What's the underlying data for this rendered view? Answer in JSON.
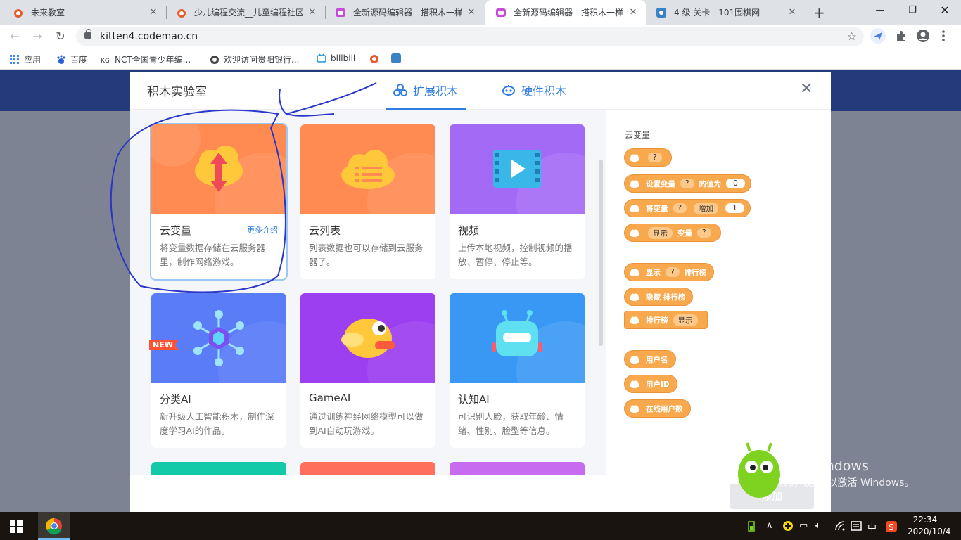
{
  "browser": {
    "tabs": [
      {
        "title": "未来教室",
        "active": false
      },
      {
        "title": "少儿编程交流__儿童编程社区_",
        "active": false
      },
      {
        "title": "全新源码编辑器 - 搭积木一样",
        "active": false
      },
      {
        "title": "全新源码编辑器 - 搭积木一样",
        "active": true
      },
      {
        "title": "4 级 关卡 - 101围棋网",
        "active": false
      }
    ],
    "new_tab": "+",
    "close_glyph": "✕",
    "url": "kitten4.codemao.cn",
    "bookmarks": [
      "应用",
      "百度",
      "NCT全国青少年编...",
      "欢迎访问贵阳银行...",
      "billbill"
    ]
  },
  "modal": {
    "title": "积木实验室",
    "tabs": [
      {
        "label": "扩展积木",
        "selected": true
      },
      {
        "label": "硬件积木",
        "selected": false
      }
    ],
    "close": "✕",
    "cards": [
      {
        "name": "云变量",
        "more": "更多介绍",
        "desc": "将变量数据存储在云服务器里，制作网络游戏。",
        "color": "#ff8a52"
      },
      {
        "name": "云列表",
        "desc": "列表数据也可以存储到云服务器了。",
        "color": "#ff8a52"
      },
      {
        "name": "视频",
        "desc": "上传本地视频，控制视频的播放、暂停、停止等。",
        "color": "#a36bf5"
      },
      {
        "name": "分类AI",
        "badge": "NEW",
        "desc": "新升级人工智能积木，制作深度学习AI的作品。",
        "color": "#5b7cf7"
      },
      {
        "name": "GameAI",
        "desc": "通过训练神经网络模型可以做到AI自动玩游戏。",
        "color": "#9b3ff0"
      },
      {
        "name": "认知AI",
        "desc": "可识别人脸，获取年龄、情绪、性别、脸型等信息。",
        "color": "#3a98f5"
      }
    ],
    "preview": {
      "title": "云变量",
      "blocks": {
        "b1_dd": "?",
        "b2_a": "设置变量",
        "b2_dd": "?",
        "b2_b": "的值为",
        "b2_num": "0",
        "b3_a": "将变量",
        "b3_dd": "?",
        "b3_dd2": "增加",
        "b3_num": "1",
        "b4_dd": "显示",
        "b4_a": "变量",
        "b4_dd2": "?",
        "b5_a": "显示",
        "b5_dd": "?",
        "b5_b": "排行榜",
        "b6_a": "隐藏 排行榜",
        "b7_a": "排行榜",
        "b7_dd": "显示",
        "b8_a": "用户名",
        "b9_a": "用户ID",
        "b10_a": "在线用户数"
      }
    },
    "add_button": "添加"
  },
  "watermark": {
    "line1": "激活 Windows",
    "line2": "转到“设置”以激活 Windows。"
  },
  "taskbar": {
    "time": "22:34",
    "date": "2020/10/4",
    "ime": "中"
  }
}
